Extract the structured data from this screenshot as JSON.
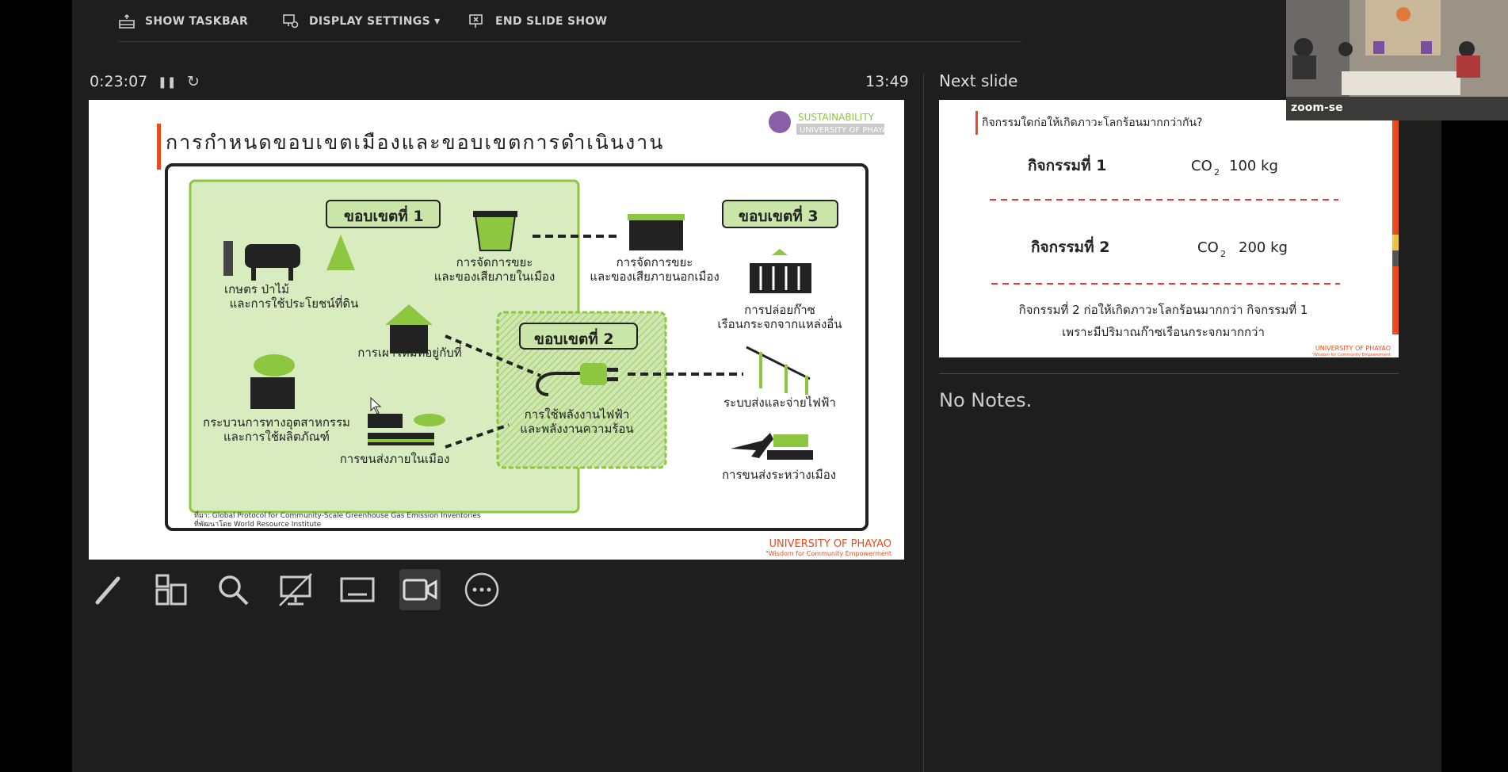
{
  "toolbar": {
    "show_taskbar": "SHOW TASKBAR",
    "display_settings": "DISPLAY SETTINGS ▾",
    "end_slide_show": "END SLIDE SHOW"
  },
  "presenter": {
    "elapsed": "0:23:07",
    "pause_icon": "❚❚",
    "restart_icon": "↻",
    "clock": "13:49",
    "next_slide_label": "Next slide",
    "notes": "No Notes."
  },
  "current_slide": {
    "title": "การกำหนดขอบเขตเมืองและขอบเขตการดำเนินงาน",
    "logo_line1": "SUSTAINABILITY",
    "logo_line2": "UNIVERSITY OF PHAYAO",
    "scope1": "ขอบเขตที่ 1",
    "scope2": "ขอบเขตที่ 2",
    "scope3": "ขอบเขตที่ 3",
    "agri": [
      "เกษตร ป่าไม้",
      "และการใช้ประโยชน์ที่ดิน"
    ],
    "waste_in": [
      "การจัดการขยะ",
      "และของเสียภายในเมือง"
    ],
    "waste_out": [
      "การจัดการขยะ",
      "และของเสียภายนอกเมือง"
    ],
    "fuel": "การเผาไหม้ที่อยู่กับที่",
    "industry": [
      "กระบวนการทางอุตสาหกรรม",
      "และการใช้ผลิตภัณฑ์"
    ],
    "transport_in": "การขนส่งภายในเมือง",
    "energy": [
      "การใช้พลังงานไฟฟ้า",
      "และพลังงานความร้อน"
    ],
    "emission": [
      "การปล่อยก๊าซ",
      "เรือนกระจกจากแหล่งอื่น"
    ],
    "grid": "ระบบส่งและจ่ายไฟฟ้า",
    "transport_out": "การขนส่งระหว่างเมือง",
    "source1": "ที่มา: Global Protocol for Community-Scale Greenhouse Gas Emission Inventories",
    "source2": "ที่พัฒนาโดย World Resource Institute",
    "footer1": "UNIVERSITY OF PHAYAO",
    "footer2": "\"Wisdom for Community Empowerment"
  },
  "next_slide": {
    "title": "กิจกรรมใดก่อให้เกิดภาวะโลกร้อนมากกว่ากัน?",
    "act1": "กิจกรรมที่ 1",
    "co2": "CO",
    "sub2": "2",
    "val1": "100 kg",
    "act2": "กิจกรรมที่ 2",
    "val2": "200 kg",
    "conclusion1": "กิจกรรมที่ 2 ก่อให้เกิดภาวะโลกร้อนมากกว่า กิจกรรมที่ 1",
    "conclusion2": "เพราะมีปริมาณก๊าซเรือนกระจกมากกว่า",
    "footer1": "UNIVERSITY OF PHAYAO",
    "footer2": "\"Wisdom for Community Empowerment"
  },
  "zoom": {
    "label": "zoom-se"
  },
  "colors": {
    "accent_green": "#8dc63f",
    "light_green": "#d8ecc0",
    "red_bar": "#e84d1c",
    "dash_red": "#e53935"
  }
}
